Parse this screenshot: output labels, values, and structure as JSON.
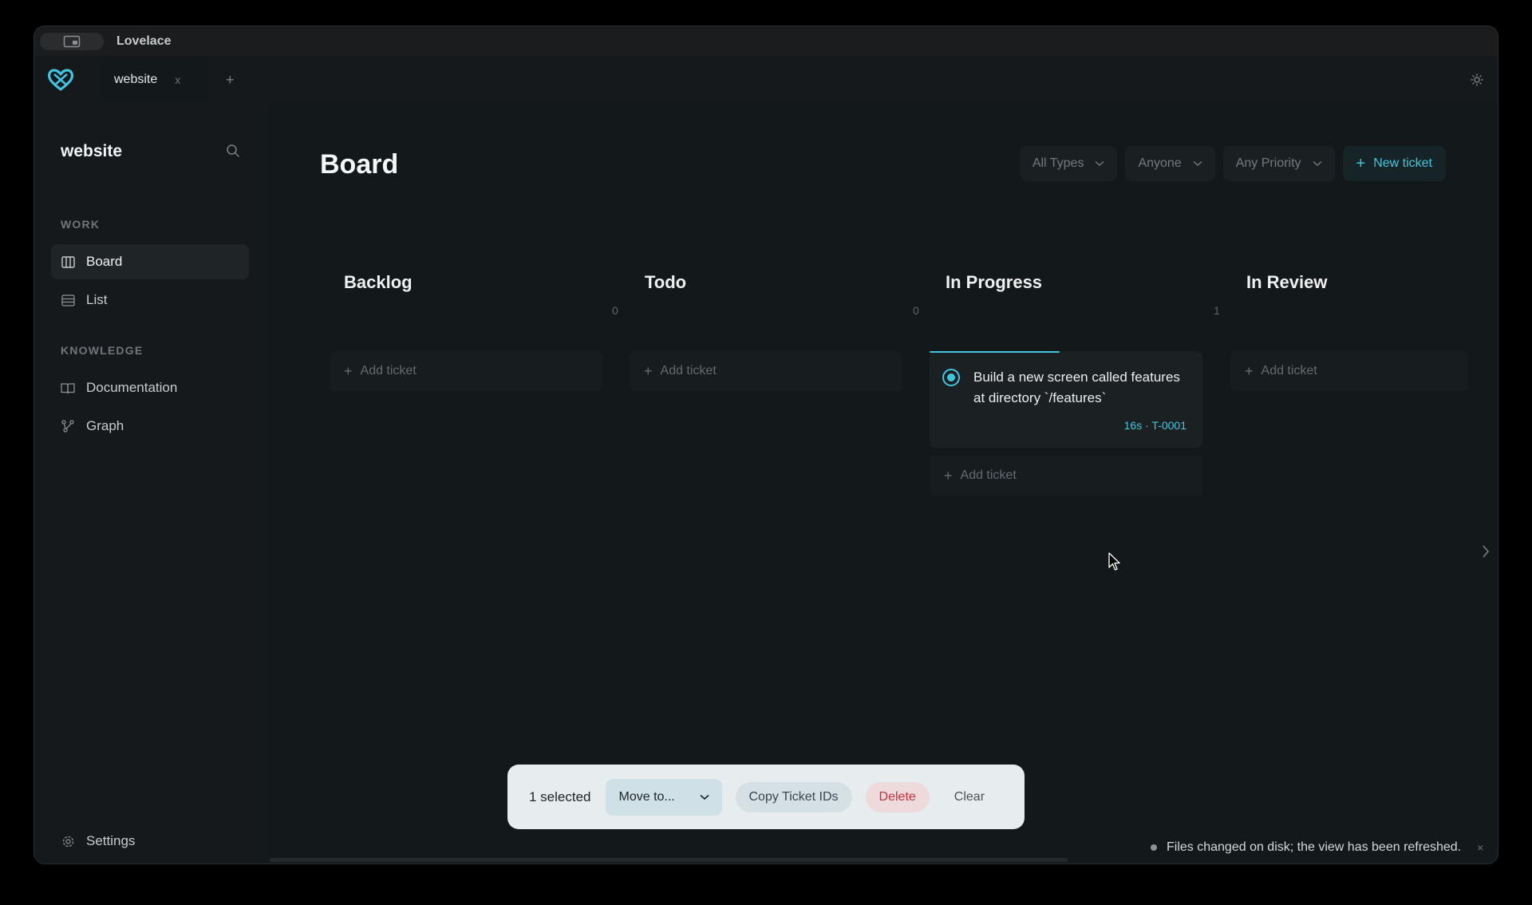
{
  "app": {
    "name": "Lovelace"
  },
  "tabs": [
    {
      "label": "website",
      "close": "x"
    }
  ],
  "add_tab": "+",
  "sidebar": {
    "project": "website",
    "sections": [
      {
        "heading": "WORK",
        "items": [
          {
            "label": "Board",
            "icon": "columns-icon",
            "active": true
          },
          {
            "label": "List",
            "icon": "list-icon"
          }
        ]
      },
      {
        "heading": "KNOWLEDGE",
        "items": [
          {
            "label": "Documentation",
            "icon": "book-icon"
          },
          {
            "label": "Graph",
            "icon": "graph-icon"
          }
        ]
      }
    ],
    "settings": "Settings"
  },
  "main": {
    "title": "Board",
    "filters": {
      "types": "All Types",
      "assignee": "Anyone",
      "priority": "Any Priority"
    },
    "new_ticket": "New ticket"
  },
  "columns": [
    {
      "name": "Backlog",
      "count": "0",
      "add": "Add ticket"
    },
    {
      "name": "Todo",
      "count": "0",
      "add": "Add ticket"
    },
    {
      "name": "In Progress",
      "count": "1",
      "add": "Add ticket"
    },
    {
      "name": "In Review",
      "count": "",
      "add": "Add ticket"
    }
  ],
  "ticket": {
    "title": "Build a new screen called features at directory `/features`",
    "meta": "16s · T-0001",
    "selected": true
  },
  "action_bar": {
    "selected": "1 selected",
    "move": "Move to...",
    "copy": "Copy Ticket IDs",
    "delete": "Delete",
    "clear": "Clear"
  },
  "toast": {
    "message": "Files changed on disk; the view has been refreshed.",
    "close": "×"
  },
  "colors": {
    "accent": "#3ec6e0",
    "danger": "#c4333f",
    "background": "#13181b"
  }
}
